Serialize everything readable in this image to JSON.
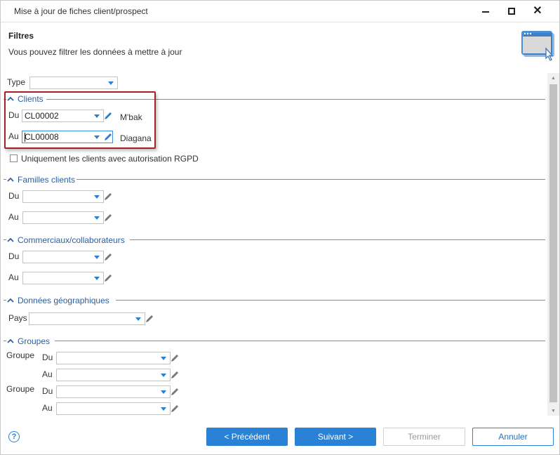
{
  "window": {
    "title": "Mise à jour de fiches client/prospect"
  },
  "header": {
    "heading": "Filtres",
    "description": "Vous pouvez filtrer les données à mettre à jour"
  },
  "form": {
    "type_label": "Type",
    "type_value": "",
    "clients": {
      "title": "Clients",
      "du_label": "Du",
      "du_value": "CL00002",
      "du_name": "M'bak",
      "au_label": "Au",
      "au_value": "CL00008",
      "au_name": "Diagana",
      "rgpd_label": "Uniquement les clients avec autorisation RGPD",
      "rgpd_checked": false
    },
    "familles": {
      "title": "Familles clients",
      "du_label": "Du",
      "au_label": "Au"
    },
    "commerciaux": {
      "title": "Commerciaux/collaborateurs",
      "du_label": "Du",
      "au_label": "Au"
    },
    "geo": {
      "title": "Données géographiques",
      "pays_label": "Pays"
    },
    "groupes": {
      "title": "Groupes",
      "rows": [
        {
          "group_label": "Groupe",
          "du_label": "Du",
          "au_label": "Au"
        },
        {
          "group_label": "Groupe",
          "du_label": "Du",
          "au_label": "Au"
        }
      ]
    }
  },
  "footer": {
    "help_glyph": "?",
    "prev_label": "< Précédent",
    "next_label": "Suivant >",
    "finish_label": "Terminer",
    "cancel_label": "Annuler"
  },
  "colors": {
    "accent": "#2a82d6",
    "group_title": "#2b5f9e",
    "highlight": "#a81f24"
  },
  "icons": {
    "minimize": "minimize-icon",
    "maximize": "maximize-icon",
    "close": "close-icon",
    "wizard": "window-cursor-icon",
    "collapse": "chevron-up-icon",
    "dropdown": "chevron-down-icon",
    "edit": "pencil-icon",
    "help": "help-icon"
  }
}
